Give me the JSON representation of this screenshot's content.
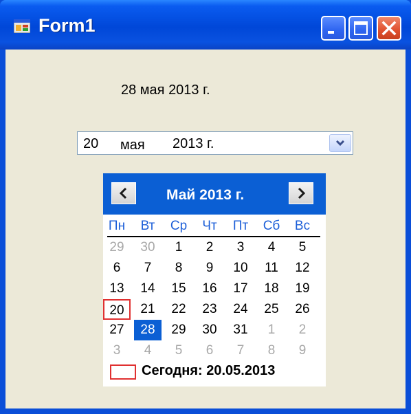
{
  "window": {
    "title": "Form1",
    "controls": {
      "minimize": "minimize-icon",
      "maximize": "maximize-icon",
      "close": "close-icon"
    }
  },
  "label": {
    "text": "28 мая 2013 г."
  },
  "date_picker": {
    "day": "20",
    "month": "мая",
    "year": "2013 г.",
    "dropdown_icon": "chevron-down-icon"
  },
  "calendar": {
    "title": "Май 2013 г.",
    "prev_icon": "chevron-left-icon",
    "next_icon": "chevron-right-icon",
    "weekdays": [
      "Пн",
      "Вт",
      "Ср",
      "Чт",
      "Пт",
      "Сб",
      "Вс"
    ],
    "weeks": [
      [
        "29",
        "30",
        "1",
        "2",
        "3",
        "4",
        "5"
      ],
      [
        "6",
        "7",
        "8",
        "9",
        "10",
        "11",
        "12"
      ],
      [
        "13",
        "14",
        "15",
        "16",
        "17",
        "18",
        "19"
      ],
      [
        "20",
        "21",
        "22",
        "23",
        "24",
        "25",
        "26"
      ],
      [
        "27",
        "28",
        "29",
        "30",
        "31",
        "1",
        "2"
      ],
      [
        "3",
        "4",
        "5",
        "6",
        "7",
        "8",
        "9"
      ]
    ],
    "today_text": "Сегодня: 20.05.2013",
    "colors": {
      "header": "#0b5fd4",
      "today_border": "#e03030",
      "selected": "#0b5fd4"
    }
  }
}
